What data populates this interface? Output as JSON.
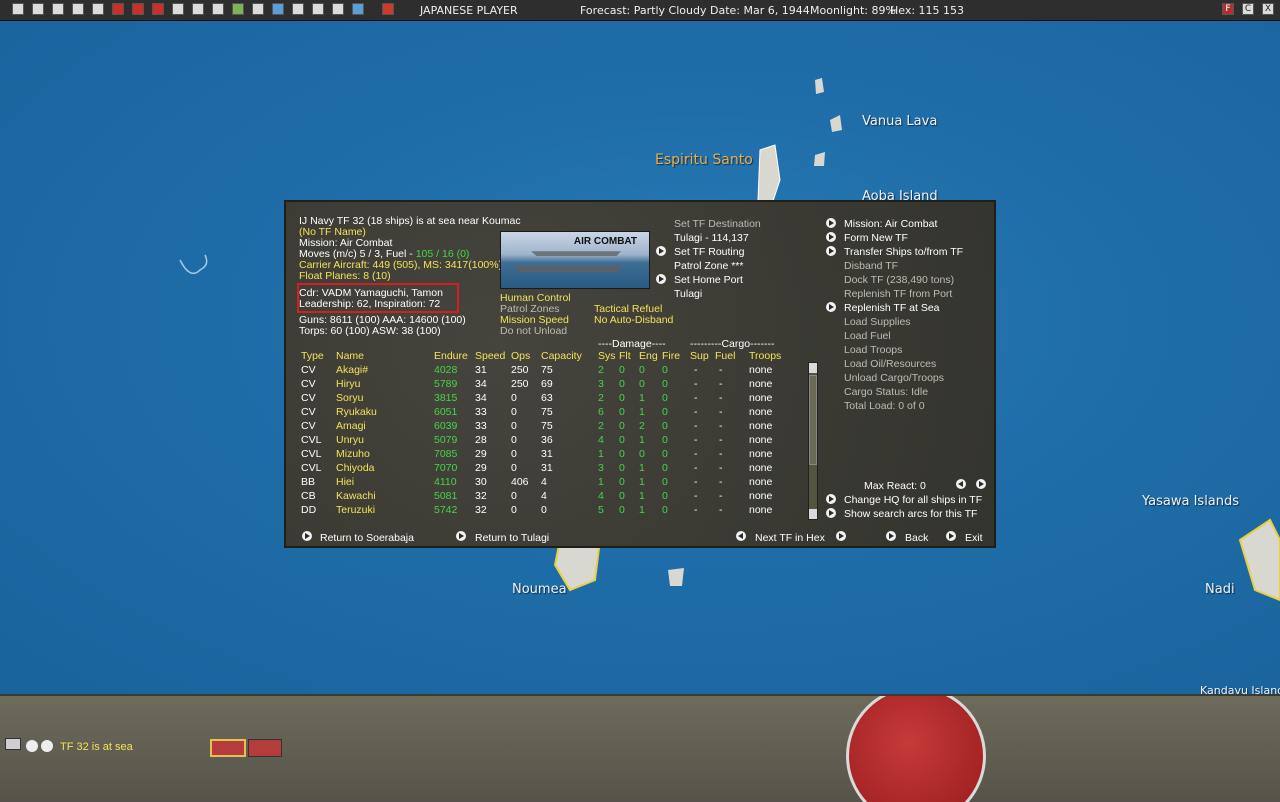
{
  "topbar": {
    "player": "JAPANESE PLAYER",
    "forecast": "Forecast: Partly Cloudy",
    "date": "Date: Mar 6, 1944",
    "moonlight": "Moonlight: 89%",
    "hex": "Hex: 115 153",
    "right_buttons": [
      "F",
      "C",
      "X"
    ]
  },
  "map": {
    "labels": [
      "Vanua Lava",
      "Espiritu Santo",
      "Aoba Island",
      "Noumea",
      "Yasawa Islands",
      "Nadi",
      "Kandavu Island"
    ]
  },
  "dialog": {
    "summary": {
      "line1": "IJ Navy TF 32 (18 ships) is at sea near Koumac",
      "name": "(No TF Name)",
      "mission": "Mission: Air Combat",
      "moves_a": "Moves (m/c) 5 / 3, Fuel - ",
      "moves_b": "105 / 16 (0)",
      "carrier": "Carrier Aircraft: 449 (505), MS: 3417(100%)",
      "float": "Float Planes: 8 (10)",
      "cdr": "Cdr: VADM Yamaguchi, Tamon",
      "leadership": "Leadership: 62, Inspiration: 72",
      "guns": "Guns: 8611 (100)  AAA: 14600 (100)",
      "torps": "Torps: 60 (100)    ASW: 38 (100)"
    },
    "picture_label": "AIR COMBAT",
    "options": [
      "Human Control",
      "Patrol Zones",
      "Mission Speed",
      "Do not Unload",
      "Tactical Refuel",
      "No Auto-Disband"
    ],
    "middle_actions": {
      "set_dest": "Set TF Destination",
      "dest": "Tulagi - 114,137",
      "routing": "Set TF Routing",
      "patrol": "Patrol Zone ***",
      "home": "Set Home Port",
      "home_value": "Tulagi"
    },
    "right_actions": [
      "Mission: Air Combat",
      "Form New TF",
      "Transfer Ships to/from TF",
      "Disband TF",
      "Dock TF (238,490 tons)",
      "Replenish TF from Port",
      "Replenish TF at Sea",
      "Load Supplies",
      "Load Fuel",
      "Load Troops",
      "Load Oil/Resources",
      "Unload Cargo/Troops",
      "Cargo Status: Idle",
      "Total Load: 0 of 0"
    ],
    "max_react": "Max React:  0",
    "change_hq": "Change HQ for all ships in TF",
    "search_arcs": "Show search arcs for this TF",
    "damage_header": "----Damage----",
    "cargo_header": "---------Cargo-------",
    "columns": [
      "Type",
      "Name",
      "Endure",
      "Speed",
      "Ops",
      "Capacity",
      "Sys",
      "Flt",
      "Eng",
      "Fire",
      "Sup",
      "Fuel",
      "Troops"
    ],
    "ships": [
      [
        "CV",
        "Akagi#",
        "4028",
        "31",
        "250",
        "75",
        "2",
        "0",
        "0",
        "0",
        "-",
        "-",
        "none"
      ],
      [
        "CV",
        "Hiryu",
        "5789",
        "34",
        "250",
        "69",
        "3",
        "0",
        "0",
        "0",
        "-",
        "-",
        "none"
      ],
      [
        "CV",
        "Soryu",
        "3815",
        "34",
        "0",
        "63",
        "2",
        "0",
        "1",
        "0",
        "-",
        "-",
        "none"
      ],
      [
        "CV",
        "Ryukaku",
        "6051",
        "33",
        "0",
        "75",
        "6",
        "0",
        "1",
        "0",
        "-",
        "-",
        "none"
      ],
      [
        "CV",
        "Amagi",
        "6039",
        "33",
        "0",
        "75",
        "2",
        "0",
        "2",
        "0",
        "-",
        "-",
        "none"
      ],
      [
        "CVL",
        "Unryu",
        "5079",
        "28",
        "0",
        "36",
        "4",
        "0",
        "1",
        "0",
        "-",
        "-",
        "none"
      ],
      [
        "CVL",
        "Mizuho",
        "7085",
        "29",
        "0",
        "31",
        "1",
        "0",
        "0",
        "0",
        "-",
        "-",
        "none"
      ],
      [
        "CVL",
        "Chiyoda",
        "7070",
        "29",
        "0",
        "31",
        "3",
        "0",
        "1",
        "0",
        "-",
        "-",
        "none"
      ],
      [
        "BB",
        "Hiei",
        "4110",
        "30",
        "406",
        "4",
        "1",
        "0",
        "1",
        "0",
        "-",
        "-",
        "none"
      ],
      [
        "CB",
        "Kawachi",
        "5081",
        "32",
        "0",
        "4",
        "4",
        "0",
        "1",
        "0",
        "-",
        "-",
        "none"
      ],
      [
        "DD",
        "Teruzuki",
        "5742",
        "32",
        "0",
        "0",
        "5",
        "0",
        "1",
        "0",
        "-",
        "-",
        "none"
      ]
    ],
    "footer": {
      "return1": "Return to Soerabaja",
      "return2": "Return to Tulagi",
      "next_tf": "Next TF in Hex",
      "back": "Back",
      "exit": "Exit"
    }
  },
  "bottom": {
    "status": "TF 32 is at sea"
  }
}
